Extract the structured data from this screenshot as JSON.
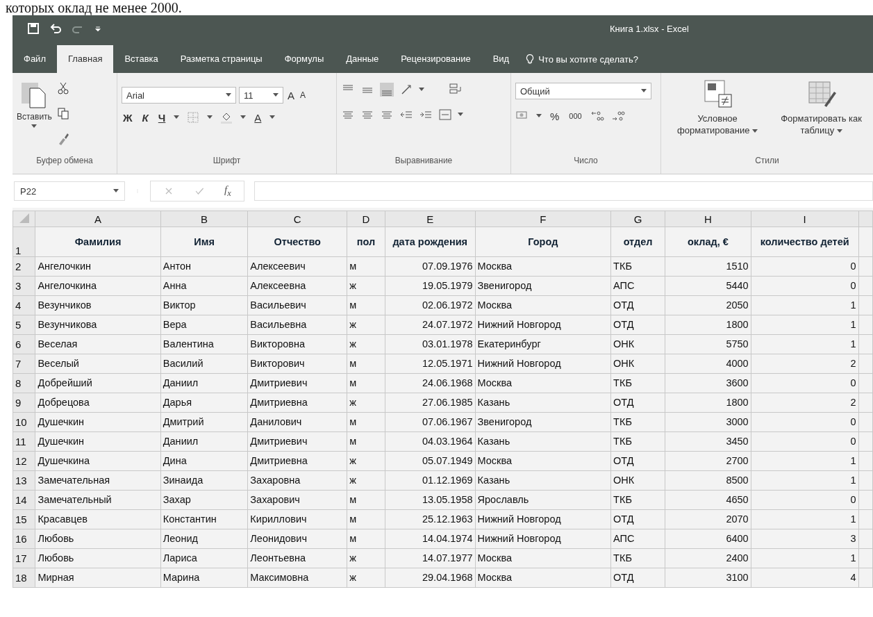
{
  "caption": "которых оклад не менее 2000.",
  "window": {
    "title": "Книга 1.xlsx - Excel"
  },
  "tabs": [
    {
      "label": "Файл",
      "selected": false
    },
    {
      "label": "Главная",
      "selected": true
    },
    {
      "label": "Вставка",
      "selected": false
    },
    {
      "label": "Разметка страницы",
      "selected": false
    },
    {
      "label": "Формулы",
      "selected": false
    },
    {
      "label": "Данные",
      "selected": false
    },
    {
      "label": "Рецензирование",
      "selected": false
    },
    {
      "label": "Вид",
      "selected": false
    }
  ],
  "tell_me": "Что вы хотите сделать?",
  "ribbon": {
    "clipboard": {
      "paste": "Вставить",
      "group": "Буфер обмена"
    },
    "font": {
      "name": "Arial",
      "size": "11",
      "grow": "A",
      "shrink": "A",
      "bold": "Ж",
      "italic": "К",
      "underline": "Ч",
      "text_color_label": "A",
      "group": "Шрифт"
    },
    "alignment": {
      "group": "Выравнивание"
    },
    "number": {
      "format": "Общий",
      "percent": "%",
      "thousands": "000",
      "group": "Число"
    },
    "styles": {
      "conditional": "Условное форматирование",
      "format_table": "Форматировать как таблицу",
      "group": "Стили"
    }
  },
  "formula_bar": {
    "name_box": "P22",
    "fx": "f$_{x}$"
  },
  "sheet": {
    "columns": [
      "A",
      "B",
      "C",
      "D",
      "E",
      "F",
      "G",
      "H",
      "I"
    ],
    "header_row_number": "1",
    "row_numbers": [
      "2",
      "3",
      "4",
      "5",
      "6",
      "7",
      "8",
      "9",
      "10",
      "11",
      "12",
      "13",
      "14",
      "15",
      "16",
      "17",
      "18"
    ],
    "header": [
      "Фамилия",
      "Имя",
      "Отчество",
      "пол",
      "дата рождения",
      "Город",
      "отдел",
      "оклад, €",
      "количество детей"
    ],
    "rows": [
      [
        "Ангелочкин",
        "Антон",
        "Алексеевич",
        "м",
        "07.09.1976",
        "Москва",
        "ТКБ",
        "1510",
        "0"
      ],
      [
        "Ангелочкина",
        "Анна",
        "Алексеевна",
        "ж",
        "19.05.1979",
        "Звенигород",
        "АПС",
        "5440",
        "0"
      ],
      [
        "Везунчиков",
        "Виктор",
        "Васильевич",
        "м",
        "02.06.1972",
        "Москва",
        "ОТД",
        "2050",
        "1"
      ],
      [
        "Везунчикова",
        "Вера",
        "Васильевна",
        "ж",
        "24.07.1972",
        "Нижний Новгород",
        "ОТД",
        "1800",
        "1"
      ],
      [
        "Веселая",
        "Валентина",
        "Викторовна",
        "ж",
        "03.01.1978",
        "Екатеринбург",
        "ОНК",
        "5750",
        "1"
      ],
      [
        "Веселый",
        "Василий",
        "Викторович",
        "м",
        "12.05.1971",
        "Нижний Новгород",
        "ОНК",
        "4000",
        "2"
      ],
      [
        "Добрейший",
        "Даниил",
        "Дмитриевич",
        "м",
        "24.06.1968",
        "Москва",
        "ТКБ",
        "3600",
        "0"
      ],
      [
        "Добрецова",
        "Дарья",
        "Дмитриевна",
        "ж",
        "27.06.1985",
        "Казань",
        "ОТД",
        "1800",
        "2"
      ],
      [
        "Душечкин",
        "Дмитрий",
        "Данилович",
        "м",
        "07.06.1967",
        "Звенигород",
        "ТКБ",
        "3000",
        "0"
      ],
      [
        "Душечкин",
        "Даниил",
        "Дмитриевич",
        "м",
        "04.03.1964",
        "Казань",
        "ТКБ",
        "3450",
        "0"
      ],
      [
        "Душечкина",
        "Дина",
        "Дмитриевна",
        "ж",
        "05.07.1949",
        "Москва",
        "ОТД",
        "2700",
        "1"
      ],
      [
        "Замечательная",
        "Зинаида",
        "Захаровна",
        "ж",
        "01.12.1969",
        "Казань",
        "ОНК",
        "8500",
        "1"
      ],
      [
        "Замечательный",
        "Захар",
        "Захарович",
        "м",
        "13.05.1958",
        "Ярославль",
        "ТКБ",
        "4650",
        "0"
      ],
      [
        "Красавцев",
        "Константин",
        "Кириллович",
        "м",
        "25.12.1963",
        "Нижний Новгород",
        "ОТД",
        "2070",
        "1"
      ],
      [
        "Любовь",
        "Леонид",
        "Леонидович",
        "м",
        "14.04.1974",
        "Нижний Новгород",
        "АПС",
        "6400",
        "3"
      ],
      [
        "Любовь",
        "Лариса",
        "Леонтьевна",
        "ж",
        "14.07.1977",
        "Москва",
        "ТКБ",
        "2400",
        "1"
      ],
      [
        "Мирная",
        "Марина",
        "Максимовна",
        "ж",
        "29.04.1968",
        "Москва",
        "ОТД",
        "3100",
        "4"
      ]
    ]
  }
}
